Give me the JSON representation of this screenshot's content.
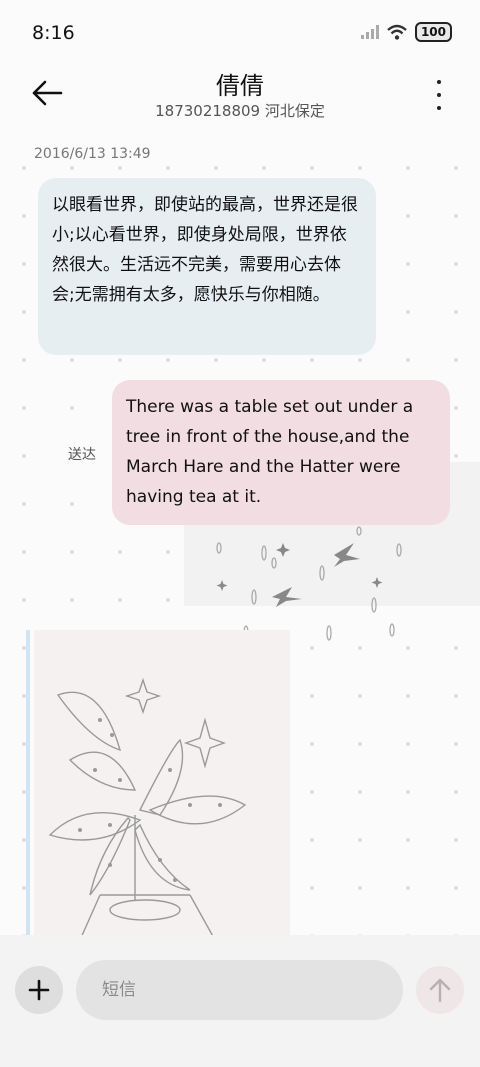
{
  "status_bar": {
    "time": "8:16",
    "battery": "100"
  },
  "header": {
    "contact_name": "倩倩",
    "subtitle": "18730218809 河北保定"
  },
  "conversation": {
    "timestamp": "2016/6/13 13:49",
    "messages": [
      {
        "direction": "incoming",
        "text": "以眼看世界，即使站的最高，世界还是很小;以心看世界，即使身处局限，世界依然很大。生活远不完美，需要用心去体会;无需拥有太多，愿快乐与你相随。"
      },
      {
        "direction": "outgoing",
        "text": "There was a table set out under a tree in front of the house,and the March Hare and the Hatter were having tea at it.",
        "status": "送达"
      }
    ]
  },
  "composer": {
    "placeholder": "短信"
  },
  "colors": {
    "incoming_bubble": "#e6eef2",
    "outgoing_bubble": "#f2dde2"
  }
}
